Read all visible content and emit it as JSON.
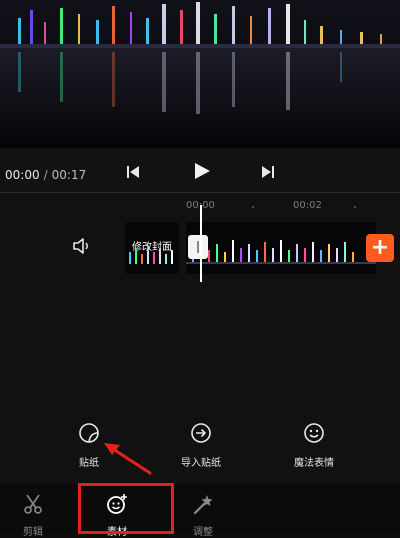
{
  "playback": {
    "current_time": "00:00",
    "separator": "/",
    "total_time": "00:17"
  },
  "timeline": {
    "ruler_start": "00:00",
    "ruler_mid": "00:02",
    "cover_label": "修改封面",
    "add_label": "+"
  },
  "sticker_tools": [
    {
      "label": "贴纸",
      "icon": "sticker-icon"
    },
    {
      "label": "导入贴纸",
      "icon": "import-arrow-icon"
    },
    {
      "label": "魔法表情",
      "icon": "smiley-icon"
    }
  ],
  "bottom_tabs": [
    {
      "label": "剪辑",
      "icon": "scissors-icon",
      "active": false
    },
    {
      "label": "素材",
      "icon": "material-icon",
      "active": true
    },
    {
      "label": "调整",
      "icon": "magic-wand-icon",
      "active": false
    }
  ],
  "colors": {
    "accent_orange": "#ff5a1f",
    "highlight_red": "#e8201a",
    "background": "#0e0e0e"
  }
}
